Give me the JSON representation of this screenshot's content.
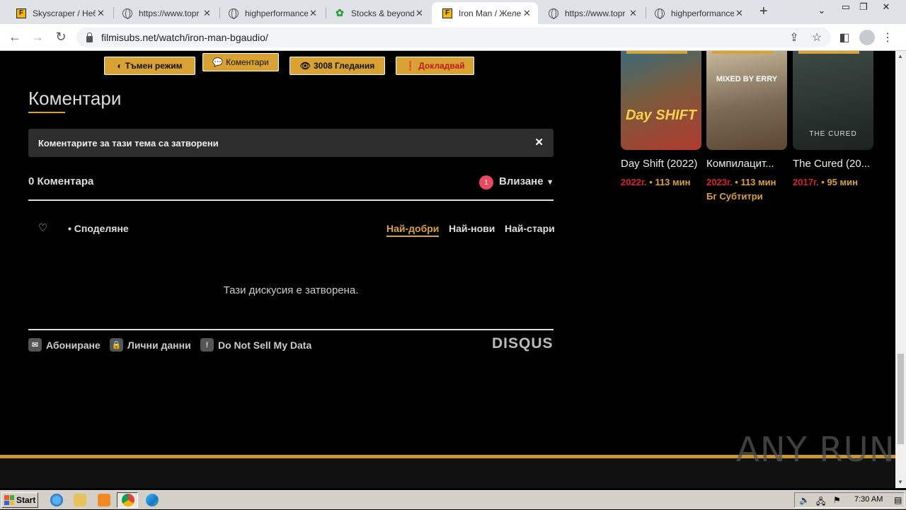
{
  "browser": {
    "tabs": [
      {
        "label": "Skyscraper / Небо",
        "icon": "filmisubs-icon",
        "active": false
      },
      {
        "label": "https://www.topr",
        "icon": "globe-icon",
        "active": false
      },
      {
        "label": "highperformanced",
        "icon": "globe-icon",
        "active": false
      },
      {
        "label": "Stocks & beyond:",
        "icon": "stocks-icon",
        "active": false
      },
      {
        "label": "Iron Man / Желе",
        "icon": "filmisubs-icon",
        "active": true
      },
      {
        "label": "https://www.topr",
        "icon": "globe-icon",
        "active": false
      },
      {
        "label": "highperformanced",
        "icon": "globe-icon",
        "active": false
      }
    ],
    "url": "filmisubs.net/watch/iron-man-bgaudio/"
  },
  "page": {
    "buttons": {
      "dark_mode": "Тъмен режим",
      "comments": "Коментари",
      "views": "3008 Гледания",
      "report": "Докладвай"
    },
    "comments_heading": "Коментари",
    "closed_notice": "Коментарите за тази тема са затворени",
    "disqus": {
      "count": "0 Коментара",
      "notifications": "1",
      "login": "Влизане",
      "share": "Споделяне",
      "sort_best": "Най-добри",
      "sort_newest": "Най-нови",
      "sort_oldest": "Най-стари",
      "closed_message": "Тази дискусия е затворена.",
      "subscribe": "Абониране",
      "privacy": "Лични данни",
      "do_not_sell": "Do Not Sell My Data",
      "brand": "DISQUS"
    },
    "related": [
      {
        "title": "Day Shift (2022)",
        "year": "2022г.",
        "meta": "113 мин",
        "poster_text": "Day SHIFT"
      },
      {
        "title": "Компилацит...",
        "year": "2023г.",
        "meta": "113 мин Бг Субтитри",
        "poster_text": "MIXED BY ERRY"
      },
      {
        "title": "The Cured (20...",
        "year": "2017г.",
        "meta": "95 мин",
        "poster_text": "THE CURED"
      }
    ],
    "watermark": "ANY RUN"
  },
  "taskbar": {
    "start": "Start",
    "time": "7:30 AM"
  },
  "colors": {
    "accent_gold": "#d9a233",
    "year_red": "#d8232f",
    "badge_red": "#e84a5f"
  }
}
